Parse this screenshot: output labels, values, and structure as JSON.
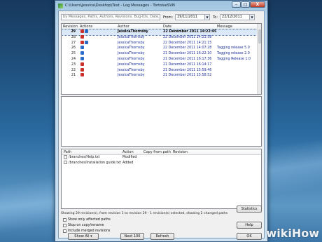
{
  "window": {
    "title": "C:\\Users\\Jessica\\Desktop\\Test - Log Messages - TortoiseSVN",
    "minimize": "–",
    "maximize": "□",
    "close": "X"
  },
  "filter": {
    "search_placeholder": "by Messages, Paths, Authors, Revisions, Bug-IDs, Date, Date",
    "from_label": "From:",
    "from_value": "29/11/2011",
    "to_label": "To:",
    "to_value": "22/12/2011"
  },
  "log_table": {
    "columns": [
      "Revision",
      "Actions",
      "Author",
      "Date",
      "Message"
    ],
    "rows": [
      {
        "rev": "29",
        "actions": [
          "red",
          "blue"
        ],
        "author": "JessicaThornsby",
        "date": "22 December 2011 14:22:45",
        "message": ""
      },
      {
        "rev": "28",
        "actions": [
          "red"
        ],
        "author": "JessicaThornsby",
        "date": "22 December 2011 14:21:58",
        "message": ""
      },
      {
        "rev": "27",
        "actions": [
          "red",
          "blue"
        ],
        "author": "JessicaThornsby",
        "date": "22 December 2011 14:21:15",
        "message": ""
      },
      {
        "rev": "26",
        "actions": [
          "blue"
        ],
        "author": "JessicaThornsby",
        "date": "22 December 2011 14:07:28",
        "message": "Tagging release 5.0"
      },
      {
        "rev": "25",
        "actions": [
          "blue"
        ],
        "author": "JessicaThornsby",
        "date": "21 December 2011 16:22:10",
        "message": "Tagging release 2.0"
      },
      {
        "rev": "24",
        "actions": [
          "blue"
        ],
        "author": "JessicaThornsby",
        "date": "21 December 2011 16:17:36",
        "message": "Tagging Release 1.0"
      },
      {
        "rev": "23",
        "actions": [
          "red"
        ],
        "author": "JessicaThornsby",
        "date": "21 December 2011 16:14:17",
        "message": ""
      },
      {
        "rev": "22",
        "actions": [
          "red"
        ],
        "author": "JessicaThornsby",
        "date": "21 December 2011 15:59:46",
        "message": ""
      },
      {
        "rev": "21",
        "actions": [
          "red"
        ],
        "author": "JessicaThornsby",
        "date": "21 December 2011 15:58:52",
        "message": ""
      }
    ]
  },
  "paths_table": {
    "columns": [
      "Path",
      "Action",
      "Copy from path",
      "Revision"
    ],
    "rows": [
      {
        "path": "/branches/Help.txt",
        "action": "Modified"
      },
      {
        "path": "/branches/Installation guide.txt",
        "action": "Added"
      }
    ]
  },
  "status_text": "Showing 29 revision(s), from revision 1 to revision 29 - 1 revision(s) selected, showing 2 changed paths",
  "checkboxes": {
    "affected_paths": "Show only affected paths",
    "stop_on_copy": "Stop on copy/rename",
    "merged": "Include merged revisions"
  },
  "buttons": {
    "statistics": "Statistics",
    "help": "Help",
    "show_all": "Show All",
    "next_100": "Next 100",
    "refresh": "Refresh",
    "ok": "OK"
  },
  "watermark": {
    "wiki": "wiki",
    "how": "How"
  }
}
